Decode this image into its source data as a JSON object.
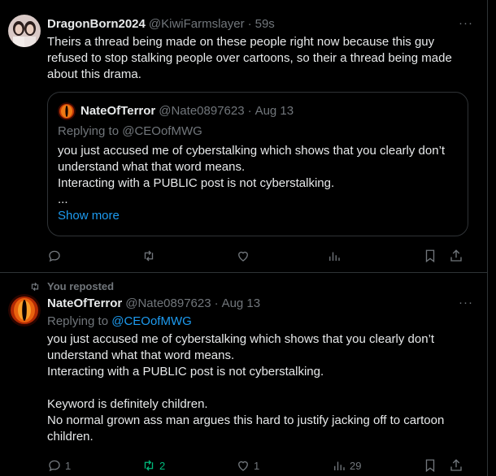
{
  "post1": {
    "display_name": "DragonBorn2024",
    "handle": "@KiwiFarmslayer",
    "separator": "·",
    "time": "59s",
    "more": "···",
    "text": "Theirs a thread being made on these people right now because this guy refused to stop stalking people over cartoons, so their a thread being made about this drama.",
    "quote": {
      "display_name": "NateOfTerror",
      "handle": "@Nate0897623",
      "separator": "·",
      "date": "Aug 13",
      "replying_prefix": "Replying to ",
      "replying_to": "@CEOofMWG",
      "text": "you just accused me of cyberstalking which shows that you clearly don’t understand what that word means.\nInteracting with a PUBLIC post is not cyberstalking.\n...",
      "show_more": "Show more"
    }
  },
  "post2": {
    "repost_label": "You reposted",
    "display_name": "NateOfTerror",
    "handle": "@Nate0897623",
    "separator": "·",
    "date": "Aug 13",
    "more": "···",
    "replying_prefix": "Replying to ",
    "replying_to": "@CEOofMWG",
    "text": "you just accused me of cyberstalking which shows that you clearly don’t understand what that word means.\nInteracting with a PUBLIC post is not cyberstalking.\n\nKeyword is definitely children.\nNo normal grown ass man argues this hard to justify jacking off to cartoon children.",
    "counts": {
      "replies": "1",
      "reposts": "2",
      "likes": "1",
      "views": "29"
    }
  },
  "colors": {
    "background": "#000000",
    "text": "#e7e9ea",
    "muted": "#71767b",
    "link": "#1d9bf0",
    "repost_active": "#00ba7c",
    "border": "#2f3336"
  },
  "icons": [
    "reply-icon",
    "repost-icon",
    "like-icon",
    "views-icon",
    "bookmark-icon",
    "share-icon",
    "more-icon"
  ]
}
